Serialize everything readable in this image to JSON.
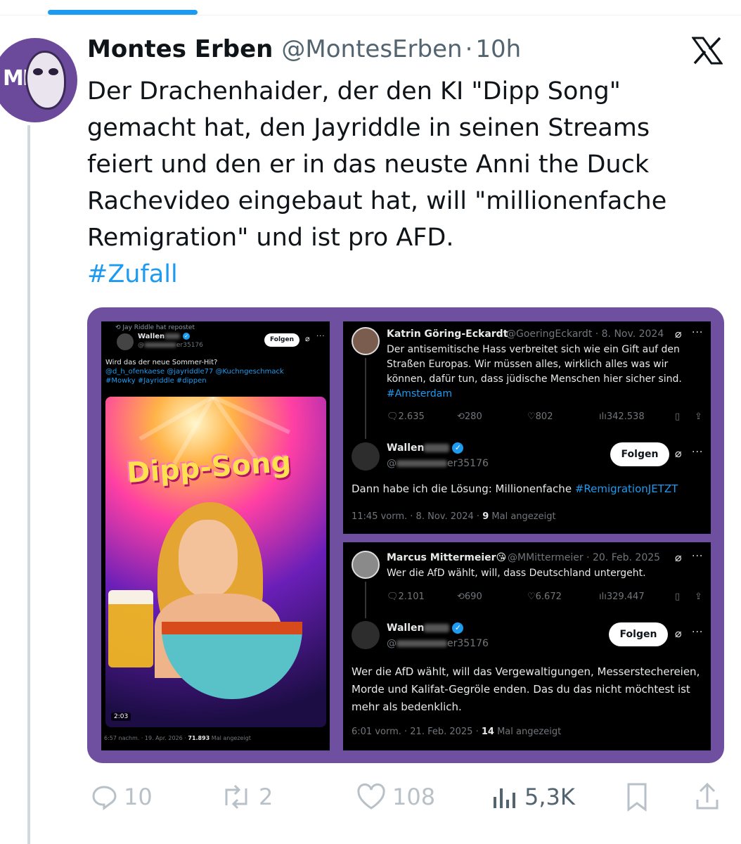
{
  "author": {
    "name": "Montes Erben",
    "handle": "@MontesErben",
    "separator": "·",
    "time": "10h",
    "avatar_text": "ME"
  },
  "tweet": {
    "text": "Der Drachenhaider, der den KI \"Dipp Song\" gemacht hat, den Jayriddle in seinen Streams feiert und den er in das neuste Anni the Duck Rachevideo eingebaut hat, will \"millionenfache Remigration\" und ist pro AFD.",
    "hashtag": "#Zufall"
  },
  "media": {
    "left": {
      "repost_note": "Jay Riddle hat repostet",
      "name": "Wallen",
      "handle_suffix": "er35176",
      "follow": "Folgen",
      "text": "Wird das der neue Sommer-Hit?",
      "mentions": "@d_h_ofenkaese @jayriddle77 @Kuchngeschmack",
      "tags": "#Mowky #Jayriddle #dippen",
      "video_title": "Dipp-Song",
      "duration": "2:03",
      "footer_time": "6:57 nachm. · 19. Apr. 2026 ·",
      "footer_views": "71.893",
      "footer_label": "Mal angezeigt"
    },
    "top_right": {
      "orig_name": "Katrin Göring-Eckardt",
      "orig_meta": "@GoeringEckardt · 8. Nov. 2024",
      "orig_text": "Der antisemitische Hass verbreitet sich wie ein Gift auf den Straßen Europas. Wir müssen alles, wirklich alles was wir können, dafür tun, dass jüdische Menschen hier sicher sind.",
      "orig_tag": "#Amsterdam",
      "stats": {
        "replies": "2.635",
        "reposts": "280",
        "likes": "802",
        "views": "342.538"
      },
      "reply_name": "Wallen",
      "reply_handle_suffix": "er35176",
      "follow": "Folgen",
      "reply_text": "Dann habe ich die Lösung: Millionenfache",
      "reply_tag": "#RemigrationJETZT",
      "footer_time": "11:45 vorm. · 8. Nov. 2024 ·",
      "footer_views": "9",
      "footer_label": "Mal angezeigt"
    },
    "bottom_right": {
      "orig_name": "Marcus Mittermeier",
      "orig_emoji": "😘",
      "orig_meta": "@MMittermeier · 20. Feb. 2025",
      "orig_text": "Wer die AfD wählt, will, dass Deutschland untergeht.",
      "stats": {
        "replies": "2.101",
        "reposts": "690",
        "likes": "6.672",
        "views": "329.447"
      },
      "reply_name": "Wallen",
      "reply_handle_suffix": "er35176",
      "follow": "Folgen",
      "reply_text": "Wer die AfD wählt, will das Vergewaltigungen, Messerstechereien, Morde und Kalifat-Gegröle enden. Das du das nicht möchtest ist mehr als bedenklich.",
      "footer_time": "6:01 vorm. · 21. Feb. 2025 ·",
      "footer_views": "14",
      "footer_label": "Mal angezeigt"
    }
  },
  "actions": {
    "replies": "10",
    "reposts": "2",
    "likes": "108",
    "views": "5,3K"
  },
  "colors": {
    "accent": "#1d9bf0",
    "frame": "#6e4fa0",
    "muted": "#536471"
  },
  "icons": [
    "x-logo-icon",
    "reply-icon",
    "repost-icon",
    "like-icon",
    "views-icon",
    "bookmark-icon",
    "share-icon",
    "verified-icon",
    "grok-icon",
    "more-icon"
  ]
}
